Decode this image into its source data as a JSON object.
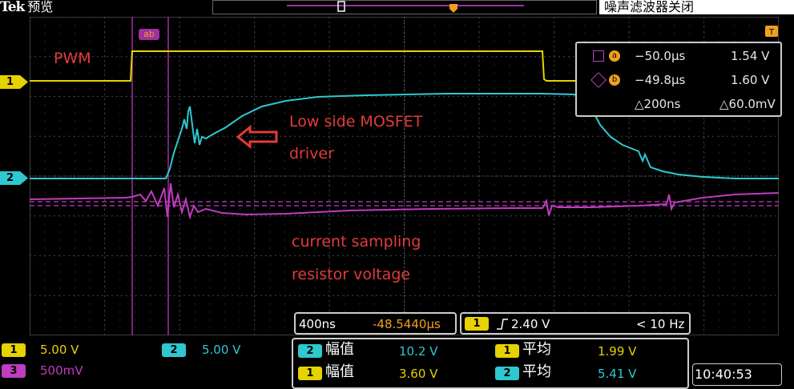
{
  "header": {
    "brand": "Tek",
    "mode": "预览",
    "right_title": "噪声滤波器关闭"
  },
  "channels": {
    "ch1_marker": "1",
    "ch2_marker": "2",
    "colors": {
      "ch1": "#e6d200",
      "ch2": "#2ec8d0",
      "ch3": "#c03cc0",
      "cursor": "#a030a0",
      "orange": "#f0a020"
    }
  },
  "annotations": {
    "pwm": "PWM",
    "low_side_line1": "Low side MOSFET",
    "low_side_line2": "driver",
    "current_line1": "current sampling",
    "current_line2": "resistor voltage"
  },
  "cursor_labels": {
    "a": "a",
    "b": "b"
  },
  "measurements": {
    "row_a": {
      "time": "−50.0µs",
      "value": "1.54 V"
    },
    "row_b": {
      "time": "−49.8µs",
      "value": "1.60 V"
    },
    "delta": {
      "time": "△200ns",
      "value": "△60.0mV"
    }
  },
  "timebase": {
    "scale": "400ns",
    "position": "-48.5440µs"
  },
  "trigger": {
    "source": "1",
    "level": "2.40 V",
    "freq": "< 10 Hz"
  },
  "scales": {
    "ch1": {
      "id": "1",
      "value": "5.00 V"
    },
    "ch2": {
      "id": "2",
      "value": "5.00 V"
    },
    "ch3": {
      "id": "3",
      "value": "500mV"
    }
  },
  "stats": {
    "r1": {
      "ch": "2",
      "name": "幅值",
      "value": "10.2 V"
    },
    "r2": {
      "ch": "1",
      "name": "幅值",
      "value": "3.60 V"
    },
    "r3": {
      "ch": "1",
      "name": "平均",
      "value": "1.99 V"
    },
    "r4": {
      "ch": "2",
      "name": "平均",
      "value": "5.41 V"
    }
  },
  "clock": "10:40:53"
}
